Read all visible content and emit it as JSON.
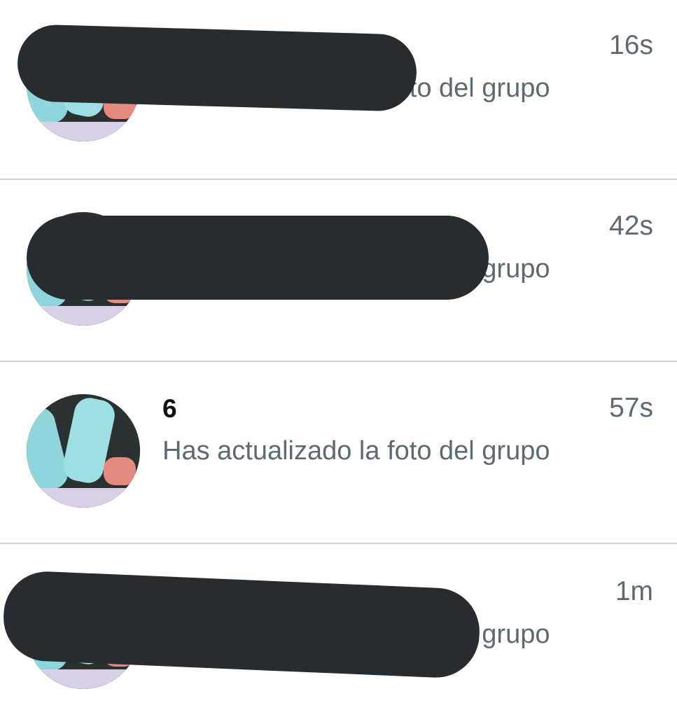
{
  "conversations": [
    {
      "title": "",
      "message": "Has actualizado la foto del grupo",
      "time": "16s"
    },
    {
      "title": "",
      "message": "Has actualizado la foto del grupo",
      "time": "42s"
    },
    {
      "title": "6",
      "message": "Has actualizado la foto del grupo",
      "time": "57s"
    },
    {
      "title": "",
      "message": "Has actualizado la foto del grupo",
      "time": "1m"
    }
  ],
  "colors": {
    "background": "#ffffff",
    "divider": "#c9d6dd",
    "title_text": "#111111",
    "secondary_text": "#5d6a70",
    "redaction": "#262c30",
    "avatar_popsicle": "#8fd5dc"
  },
  "icons": {
    "avatar": "group-photo-avatar-popsicles"
  }
}
